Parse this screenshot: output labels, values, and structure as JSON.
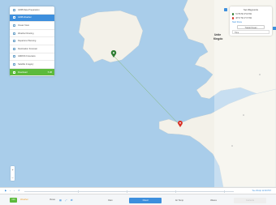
{
  "sidebar": {
    "items": [
      {
        "icon": "grid-icon",
        "label": "GRIB Data Preparation"
      },
      {
        "icon": "route-icon",
        "label": "GRIB Weather",
        "active": true
      },
      {
        "icon": "table-icon",
        "label": "Ocean View"
      },
      {
        "icon": "route-icon",
        "label": "Weather Routing"
      },
      {
        "icon": "compass-icon",
        "label": "Departure Planning"
      },
      {
        "icon": "chart-icon",
        "label": "Destination Forecast"
      },
      {
        "icon": "cloud-icon",
        "label": "GMDSS Forecasts"
      },
      {
        "icon": "image-icon",
        "label": "Satellite Imagery"
      }
    ],
    "download": {
      "label": "Download",
      "size": "5 kB"
    }
  },
  "right_panel": {
    "title": "Set Waypoints",
    "waypoints": [
      {
        "color": "#2f7d32",
        "label": "51°35.5N 9°18.5W"
      },
      {
        "color": "#d93025",
        "label": "48°17.5N 4°37.5W"
      }
    ],
    "link": "Start Route",
    "button": "Transit Ocean",
    "input_value": "Time"
  },
  "map": {
    "labels": [
      {
        "text": "Unite"
      },
      {
        "text": "Kingdo"
      }
    ]
  },
  "zoom": {
    "plus": "+",
    "minus": "–"
  },
  "timeline": {
    "right_label": "Tue 29 Apr 12:00 PST"
  },
  "bottom_bar": {
    "on_label": "ON",
    "mode_label": "Weather",
    "grid_label": "Views",
    "tabs": [
      {
        "label": "Rain",
        "state": "normal"
      },
      {
        "label": "Cloud",
        "state": "active"
      },
      {
        "label": "Air Temp",
        "state": "normal"
      },
      {
        "label": "Waves",
        "state": "normal"
      },
      {
        "label": "Currents",
        "state": "disabled"
      }
    ]
  },
  "colors": {
    "accent": "#3d8fdd",
    "green": "#5cba3c",
    "sea": "#a9cdea",
    "land": "#f3f1e9"
  }
}
